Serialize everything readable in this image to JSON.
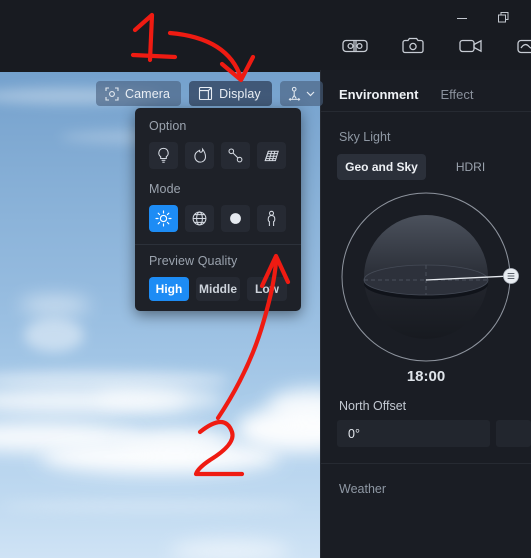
{
  "window": {
    "controls": [
      {
        "name": "minimize",
        "glyph": "minimize-icon"
      },
      {
        "name": "restore",
        "glyph": "restore-icon"
      }
    ],
    "toolbar_icons": [
      {
        "name": "vr-goggles-icon"
      },
      {
        "name": "camera-icon"
      },
      {
        "name": "video-camera-icon"
      },
      {
        "name": "panorama-icon"
      }
    ]
  },
  "viewport_toolbar": {
    "camera_label": "Camera",
    "display_label": "Display",
    "camera_icon": "camera-frame-icon",
    "display_icon": "cube-icon",
    "walk_icon": "person-navigate-icon",
    "chevron_icon": "chevron-down-icon"
  },
  "display_panel": {
    "option": {
      "label": "Option",
      "items": [
        {
          "name": "light-bulb-icon",
          "selected": false
        },
        {
          "name": "fire-icon",
          "selected": false
        },
        {
          "name": "measure-icon",
          "selected": false
        },
        {
          "name": "grid-icon",
          "selected": false
        }
      ]
    },
    "mode": {
      "label": "Mode",
      "items": [
        {
          "name": "sun-shaded-icon",
          "selected": true
        },
        {
          "name": "wireframe-globe-icon",
          "selected": false
        },
        {
          "name": "solid-circle-icon",
          "selected": false
        },
        {
          "name": "person-icon",
          "selected": false
        }
      ]
    },
    "preview_quality": {
      "label": "Preview Quality",
      "options": [
        {
          "label": "High",
          "selected": true
        },
        {
          "label": "Middle",
          "selected": false
        },
        {
          "label": "Low",
          "selected": false
        }
      ]
    }
  },
  "right_panel": {
    "tabs": [
      {
        "label": "Environment",
        "active": true
      },
      {
        "label": "Effect",
        "active": false
      }
    ],
    "sky_light": {
      "label": "Sky Light",
      "source_options": [
        {
          "label": "Geo and Sky",
          "selected": true
        },
        {
          "label": "HDRI",
          "selected": false
        }
      ],
      "time_value": "18:00",
      "sun_handle_icon": "sun-handle-icon"
    },
    "north_offset": {
      "label": "North Offset",
      "value": "0°"
    },
    "weather": {
      "label": "Weather"
    }
  },
  "annotations": [
    {
      "label": "1",
      "target": "display-button"
    },
    {
      "label": "2",
      "target": "person-mode-icon"
    }
  ],
  "colors": {
    "accent": "#1d8cf5",
    "panel_bg": "#1e2128",
    "right_panel_bg": "#1a1d24",
    "titlebar_bg": "#181b21",
    "annotation_red": "#ef1b12"
  }
}
